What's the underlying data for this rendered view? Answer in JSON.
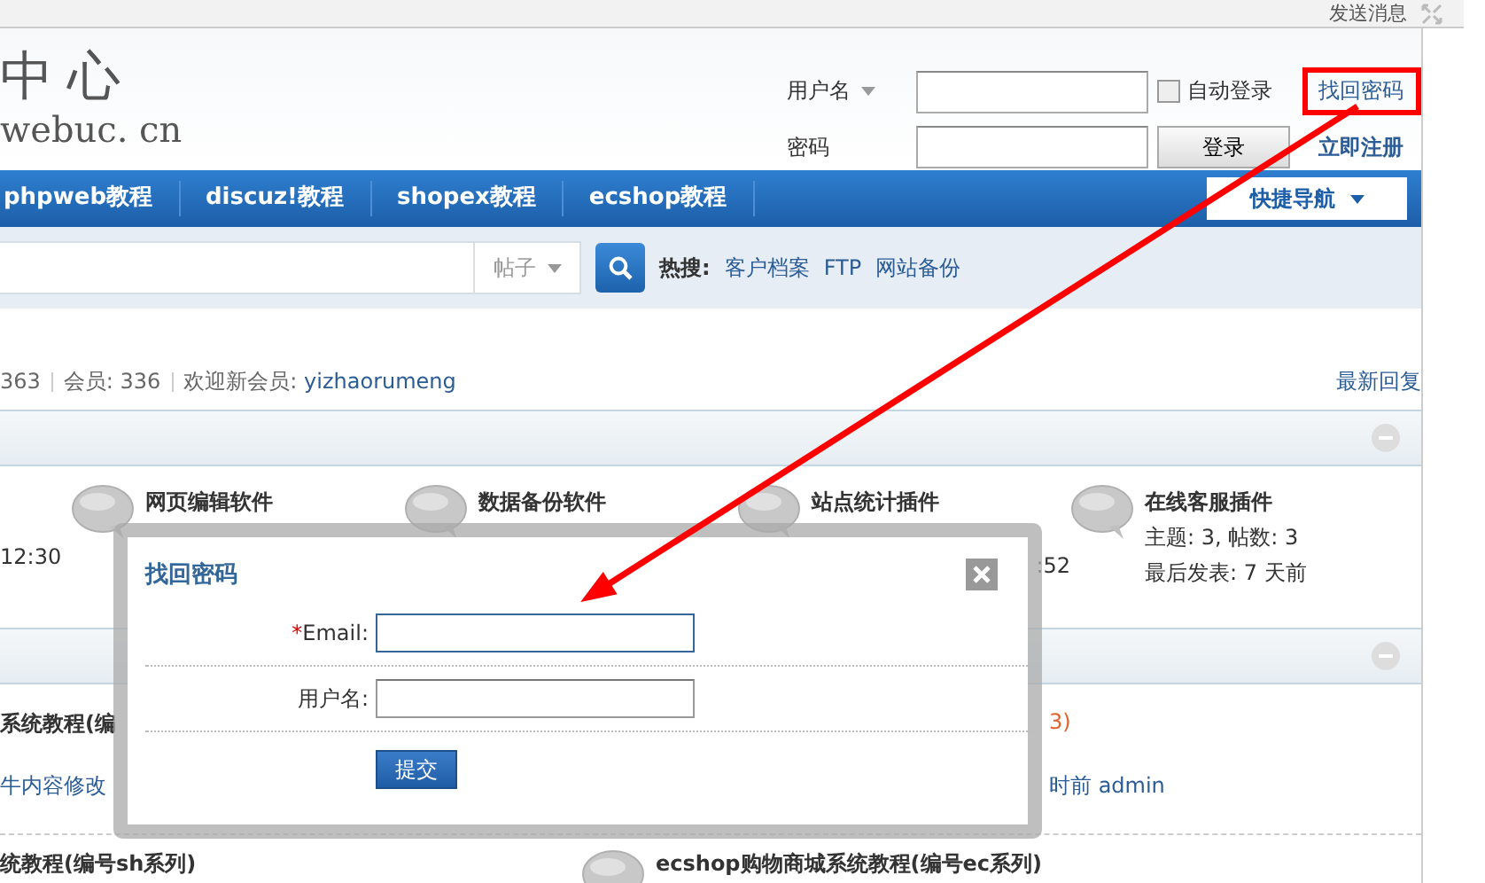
{
  "top_bar": {
    "link": "发送消息"
  },
  "logo": {
    "title": "中心",
    "domain": "webuc. cn"
  },
  "login": {
    "username_label": "用户名",
    "password_label": "密码",
    "auto_login": {
      "label": "自动登录",
      "checked": false
    },
    "forgot": "找回密码",
    "login_button": "登录",
    "register": "立即注册"
  },
  "nav": {
    "items": [
      {
        "label": "phpweb教程"
      },
      {
        "label": "discuz!教程"
      },
      {
        "label": "shopex教程"
      },
      {
        "label": "ecshop教程"
      }
    ],
    "quick_nav": "快捷导航"
  },
  "search": {
    "type": "帖子",
    "hot_label": "热搜:",
    "hot_links": [
      "客户档案",
      "FTP",
      "网站备份"
    ]
  },
  "stats": {
    "posts": "363",
    "members": "会员: 336",
    "welcome": "欢迎新会员: ",
    "new_member": "yizhaorumeng",
    "latest": "最新回复"
  },
  "forums": {
    "leading_time": "12:30",
    "items": [
      {
        "name": "网页编辑软件"
      },
      {
        "name": "数据备份软件"
      },
      {
        "name": "站点统计插件",
        "last": ":52"
      },
      {
        "name": "在线客服插件",
        "stats": "主题: 3, 帖数: 3",
        "last": "最后发表: 7 天前"
      }
    ]
  },
  "threads": {
    "left": [
      {
        "kind": "title",
        "text": "系统教程(编"
      },
      {
        "kind": "meta",
        "text": "牛内容修改"
      }
    ],
    "right": [
      {
        "kind": "count",
        "text": "3)"
      },
      {
        "kind": "meta",
        "text": "时前 admin"
      }
    ],
    "bottom_left": "统教程(编号sh系列)",
    "featured": "ecshop购物商城系统教程(编号ec系列)"
  },
  "dialog": {
    "title": "找回密码",
    "fields": [
      {
        "label": "Email:",
        "mark": "*",
        "focused": true
      },
      {
        "label": "用户名:",
        "focused": false
      }
    ],
    "submit": "提交"
  }
}
